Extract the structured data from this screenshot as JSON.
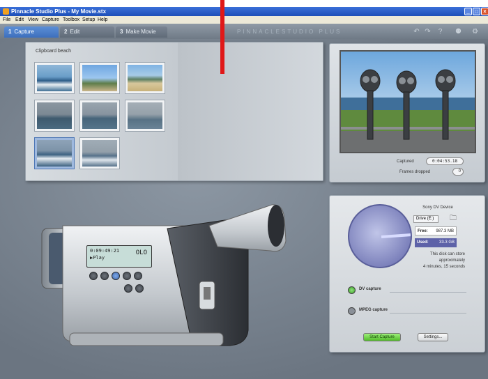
{
  "window": {
    "title": "Pinnacle Studio Plus - My Movie.stx",
    "buttons": {
      "minimize": "_",
      "maximize": "□",
      "close": "×"
    }
  },
  "menu": [
    "File",
    "Edit",
    "View",
    "Capture",
    "Toolbox",
    "Setup",
    "Help"
  ],
  "tabs": [
    {
      "num": "1",
      "label": "Capture"
    },
    {
      "num": "2",
      "label": "Edit"
    },
    {
      "num": "3",
      "label": "Make Movie"
    }
  ],
  "brand": "PINNACLESTUDIO PLUS",
  "toolbar_icons": [
    "undo-icon",
    "redo-icon",
    "help-icon",
    "idea-icon",
    "settings-icon"
  ],
  "album": {
    "heading": "Clipboard beach"
  },
  "player": {
    "captured_label": "Captured",
    "captured_value": "0:04:53.18",
    "frames_dropped_label": "Frames dropped",
    "frames_dropped_value": "0"
  },
  "camcorder": {
    "timecode": "0:09:49:21",
    "mode": "Play",
    "icon_badge": "OLO"
  },
  "capture": {
    "device": "Sony DV Device",
    "drive": "Drive (E:)",
    "free_label": "Free:",
    "free_value": "987.3 MB",
    "used_label": "Used:",
    "used_value": "33.3 GB",
    "desc_lines": [
      "This disk can store",
      "approximately",
      "4 minutes, 15 seconds"
    ],
    "dv_label": "DV capture",
    "mpeg_label": "MPEG capture",
    "start_label": "Start Capture",
    "settings_label": "Settings..."
  },
  "colors": {
    "accent": "#3d6fbd",
    "annotation": "#e01818",
    "capture_button": "#52bc2a"
  }
}
